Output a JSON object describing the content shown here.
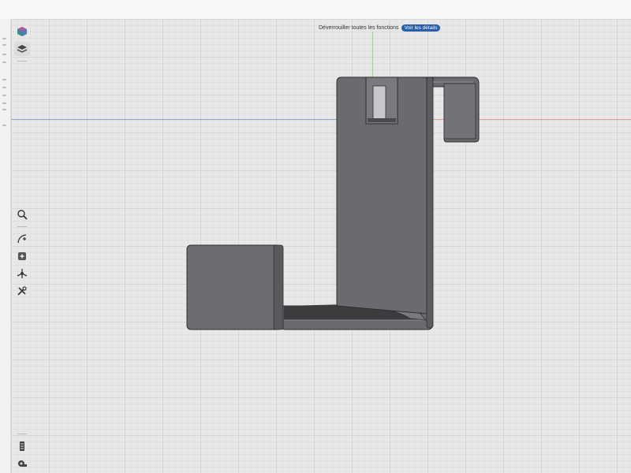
{
  "banner": {
    "message": "Déverrouiller toutes les fonctions",
    "button_label": "Voir les détails"
  },
  "colors": {
    "model_fill": "#6b6b6f",
    "model_dark": "#3a3a3d",
    "accent": "#2a5ea8",
    "axis_x_neg": "#8aa9d9",
    "axis_x_pos": "#e79a9a",
    "axis_y": "#9ccf9c"
  },
  "toolbar_top": [
    {
      "name": "view-cube-icon"
    },
    {
      "name": "layers-icon"
    }
  ],
  "toolbar_mid": [
    {
      "name": "search-icon"
    },
    {
      "name": "sketch-curve-icon"
    },
    {
      "name": "add-box-icon"
    },
    {
      "name": "transform-icon"
    },
    {
      "name": "tools-icon"
    }
  ],
  "toolbar_bottom": [
    {
      "name": "timeline-icon"
    },
    {
      "name": "measure-icon"
    }
  ]
}
